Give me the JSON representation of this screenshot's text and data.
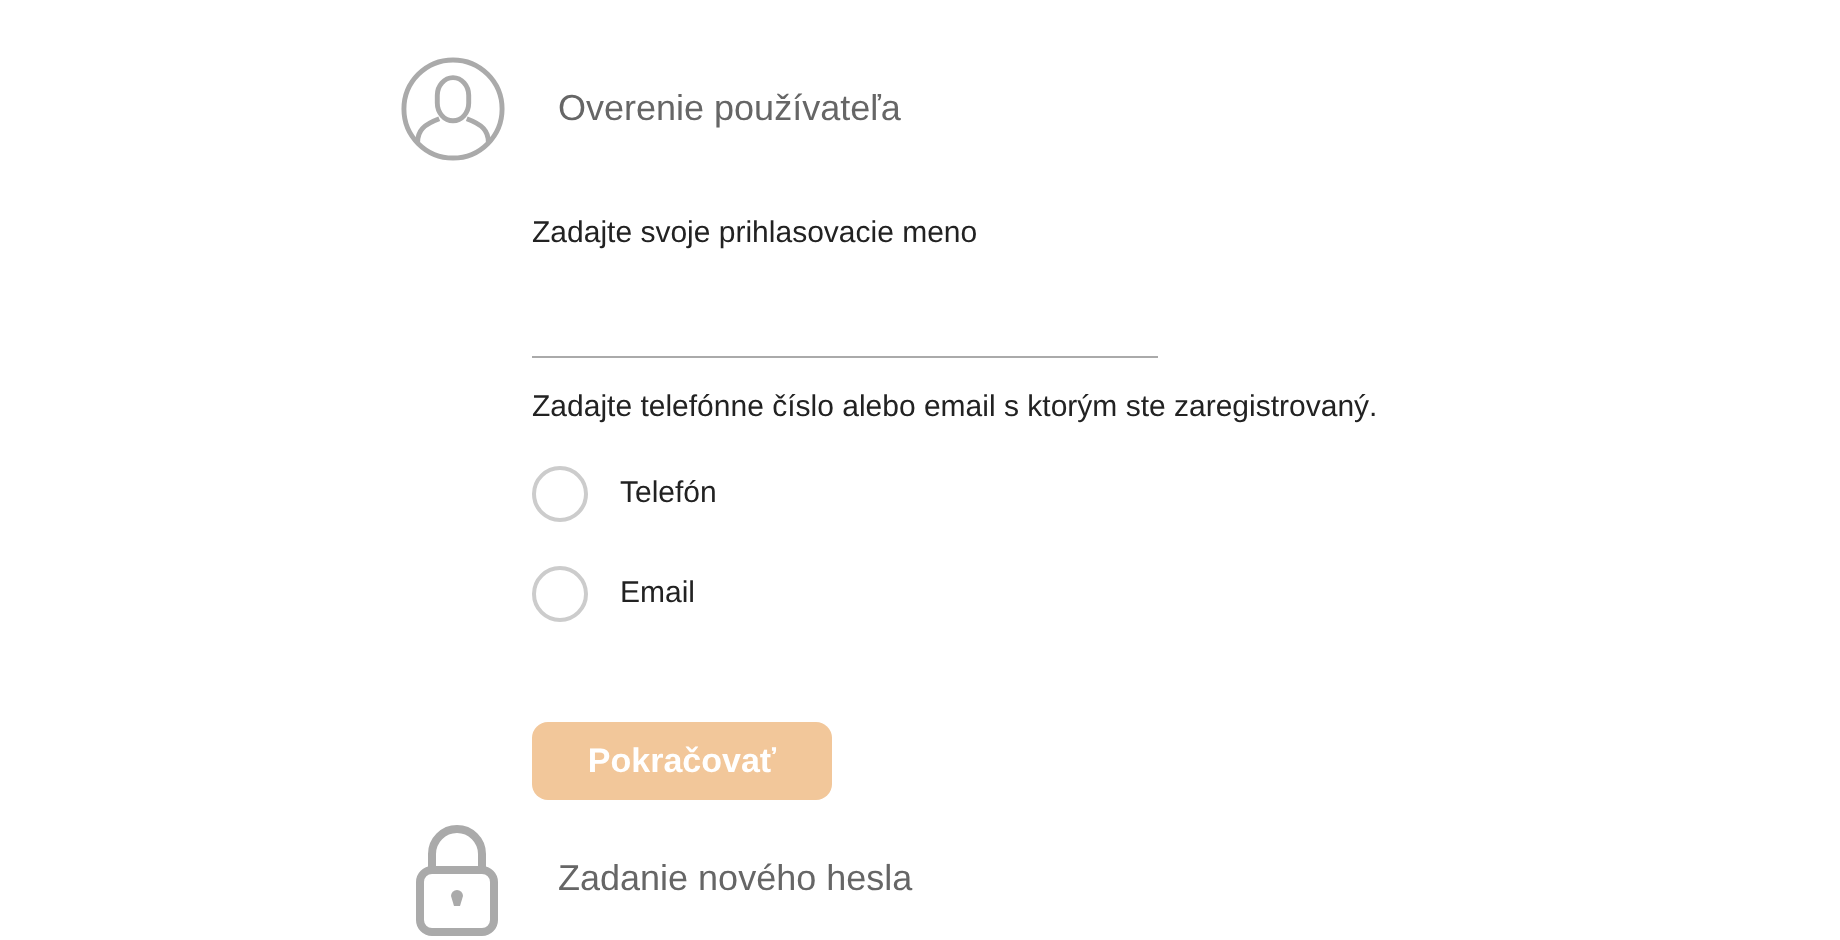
{
  "steps": [
    {
      "kind": "user",
      "title": "Overenie používateľa"
    },
    {
      "kind": "lock",
      "title": "Zadanie nového hesla"
    }
  ],
  "username_label": "Zadajte svoje prihlasovacie meno",
  "contact_label": "Zadajte telefónne číslo alebo email s ktorým ste zaregistrovaný.",
  "options": [
    {
      "label": "Telefón",
      "selected": false
    },
    {
      "label": "Email",
      "selected": false
    }
  ],
  "continue_button": {
    "label": "Pokračovať",
    "disabled": true
  }
}
